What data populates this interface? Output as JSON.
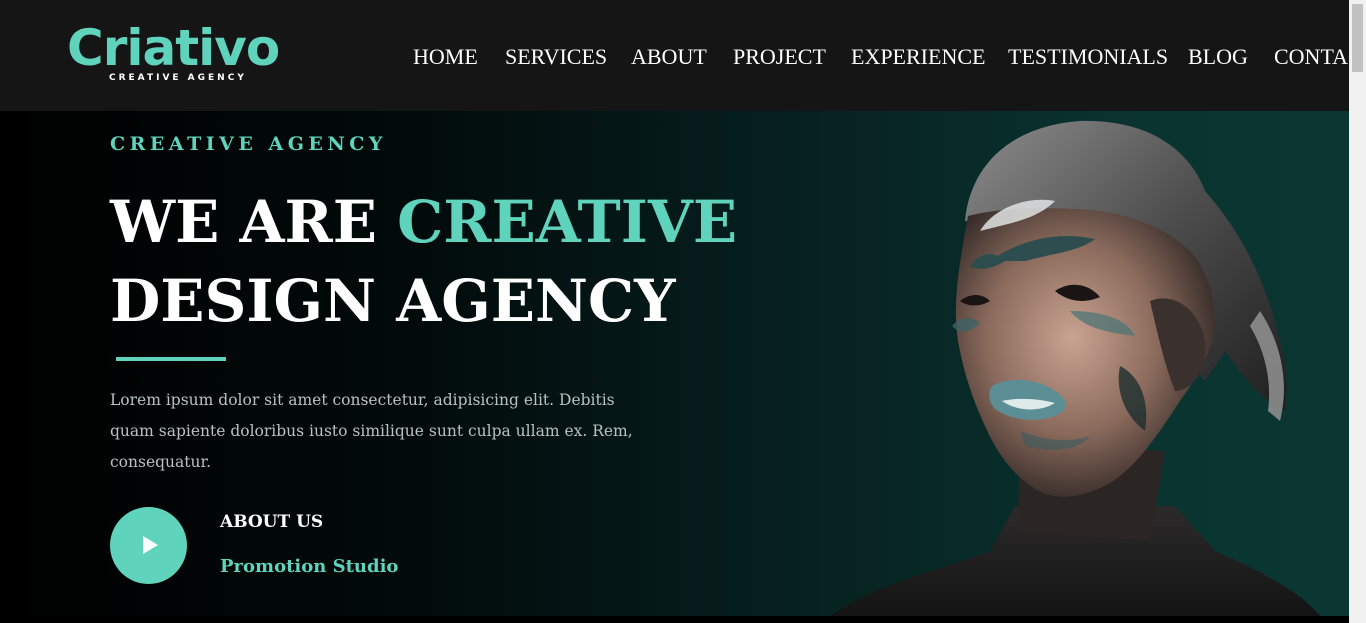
{
  "header": {
    "logo": {
      "name": "Criativo",
      "tagline": "CREATIVE AGENCY"
    },
    "nav": [
      "HOME",
      "SERVICES",
      "ABOUT",
      "PROJECT",
      "EXPERIENCE",
      "TESTIMONIALS",
      "BLOG",
      "CONTACT"
    ]
  },
  "hero": {
    "eyebrow": "CREATIVE AGENCY",
    "headline_part1": "WE ARE ",
    "headline_accent": "CREATIVE",
    "headline_line2": "DESIGN AGENCY",
    "lead": "Lorem ipsum dolor sit amet consectetur, adipisicing elit. Debitis quam sapiente doloribus iusto similique sunt culpa ullam ex. Rem, consequatur.",
    "cta_title": "ABOUT US",
    "cta_sub": "Promotion Studio",
    "play_icon": "play-icon",
    "portrait": "portrait-image"
  },
  "colors": {
    "accent": "#5fd3bc",
    "header_bg": "#151515",
    "hero_dark": "#000000",
    "hero_teal": "#0b3632",
    "text_white": "#ffffff",
    "text_muted": "#b9c2c1"
  }
}
